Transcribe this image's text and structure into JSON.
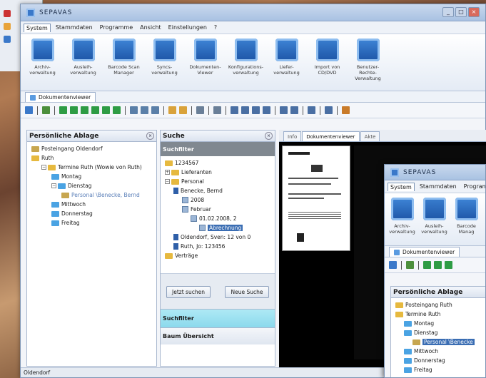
{
  "app_title": "SEPAVAS",
  "menu": [
    "System",
    "Stammdaten",
    "Programme",
    "Ansicht",
    "Einstellungen",
    "?"
  ],
  "ribbon": [
    {
      "label": "Archiv-\nverwaltung",
      "icon": "archive-icon"
    },
    {
      "label": "Ausleih-\nverwaltung",
      "icon": "lend-icon"
    },
    {
      "label": "Barcode Scan\nManager",
      "icon": "barcode-scan-icon"
    },
    {
      "label": "Syncs-\nverwaltung",
      "icon": "sync-icon"
    },
    {
      "label": "Dokumenten-\nViewer",
      "icon": "document-viewer-icon"
    },
    {
      "label": "Konfigurations-\nverwaltung",
      "icon": "config-tools-icon"
    },
    {
      "label": "Liefer-\nverwaltung",
      "icon": "delivery-box-icon"
    },
    {
      "label": "Import von\nCD/DVD",
      "icon": "import-cd-icon"
    },
    {
      "label": "Benutzer-Rechte-\nVerwaltung",
      "icon": "user-rights-icon"
    }
  ],
  "doc_tab": "Dokumentenviewer",
  "left_panel": {
    "title": "Persönliche Ablage",
    "items": [
      {
        "label": "Posteingang Oldendorf",
        "level": 0,
        "folder": "gray"
      },
      {
        "label": "Ruth",
        "level": 0,
        "folder": "yellow"
      },
      {
        "label": "Termine Ruth (Wowie von Ruth)",
        "level": 1,
        "folder": "yellow"
      },
      {
        "label": "Montag",
        "level": 2,
        "folder": "blue"
      },
      {
        "label": "Dienstag",
        "level": 2,
        "folder": "blue"
      },
      {
        "label": "Personal \\Benecke, Bernd",
        "level": 3,
        "folder": "gray"
      },
      {
        "label": "Mittwoch",
        "level": 2,
        "folder": "blue"
      },
      {
        "label": "Donnerstag",
        "level": 2,
        "folder": "blue"
      },
      {
        "label": "Freitag",
        "level": 2,
        "folder": "blue"
      }
    ]
  },
  "search_panel": {
    "title": "Suche",
    "header": "Suchfilter",
    "tree": [
      {
        "label": "1234567",
        "level": 0,
        "type": "folder"
      },
      {
        "label": "Lieferanten",
        "level": 0,
        "type": "folder"
      },
      {
        "label": "Personal",
        "level": 0,
        "type": "folder"
      },
      {
        "label": "Benecke, Bernd",
        "level": 1,
        "type": "doc"
      },
      {
        "label": "2008",
        "level": 2,
        "type": "cal"
      },
      {
        "label": "Februar",
        "level": 2,
        "type": "cal"
      },
      {
        "label": "01.02.2008, 2",
        "level": 3,
        "type": "cal"
      },
      {
        "label": "Abrechnung",
        "level": 4,
        "type": "sel"
      },
      {
        "label": "Oldendorf, Sven: 12 von 0",
        "level": 1,
        "type": "doc"
      },
      {
        "label": "Ruth, Jo: 123456",
        "level": 1,
        "type": "doc"
      },
      {
        "label": "Verträge",
        "level": 0,
        "type": "folder"
      }
    ],
    "btn_search": "Jetzt suchen",
    "btn_new": "Neue Suche",
    "accordion": [
      "Suchfilter",
      "Baum Übersicht"
    ]
  },
  "viewer_tabs": [
    "Info",
    "Dokumentenviewer",
    "Akte"
  ],
  "status_text": "Oldendorf",
  "window2": {
    "title": "SEPAVAS",
    "menu": [
      "System",
      "Stammdaten",
      "Programme"
    ],
    "ribbon": [
      {
        "label": "Archiv-\nverwaltung"
      },
      {
        "label": "Ausleih-\nverwaltung"
      },
      {
        "label": "Barcode\nManag"
      }
    ],
    "doc_tab": "Dokumentenviewer",
    "panel_title": "Persönliche Ablage",
    "items": [
      {
        "label": "Posteingang Ruth",
        "level": 0
      },
      {
        "label": "Termine Ruth",
        "level": 0
      },
      {
        "label": "Montag",
        "level": 1
      },
      {
        "label": "Dienstag",
        "level": 1
      },
      {
        "label": "Personal \\Benecke",
        "level": 2
      },
      {
        "label": "Mittwoch",
        "level": 1
      },
      {
        "label": "Donnerstag",
        "level": 1
      },
      {
        "label": "Freitag",
        "level": 1
      }
    ]
  }
}
